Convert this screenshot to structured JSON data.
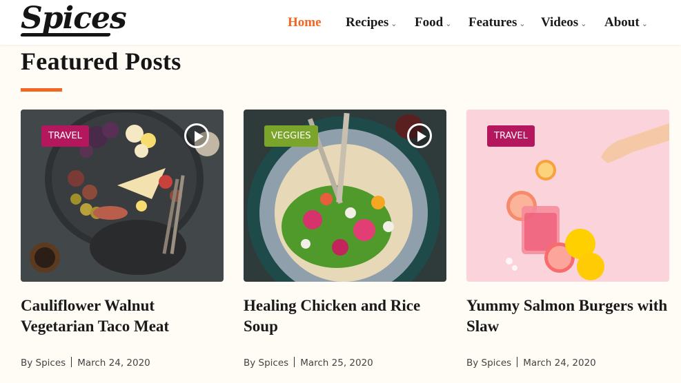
{
  "header": {
    "logo": "Spices",
    "nav": [
      {
        "label": "Home",
        "active": true,
        "dropdown": false
      },
      {
        "label": "Recipes",
        "active": false,
        "dropdown": true
      },
      {
        "label": "Food",
        "active": false,
        "dropdown": true
      },
      {
        "label": "Features",
        "active": false,
        "dropdown": true
      },
      {
        "label": "Videos",
        "active": false,
        "dropdown": true
      },
      {
        "label": "About",
        "active": false,
        "dropdown": true
      }
    ]
  },
  "colors": {
    "accent": "#f26522",
    "badge_travel": "#b5175e",
    "badge_veggies": "#7aa42a",
    "background": "#fffbf5"
  },
  "section": {
    "title": "Featured Posts"
  },
  "posts": [
    {
      "category": "Travel",
      "has_video": true,
      "title_line1": "Cauliflower Walnut",
      "title_line2": "Vegetarian Taco Meat",
      "author": "By Spices",
      "date": "March 24, 2020"
    },
    {
      "category": "Veggies",
      "has_video": true,
      "title_line1": "Healing Chicken and Rice",
      "title_line2": "Soup",
      "author": "By Spices",
      "date": "March 25, 2020"
    },
    {
      "category": "Travel",
      "has_video": false,
      "title_line1": "Yummy Salmon Burgers with",
      "title_line2": "Slaw",
      "author": "By Spices",
      "date": "March 24, 2020"
    }
  ]
}
